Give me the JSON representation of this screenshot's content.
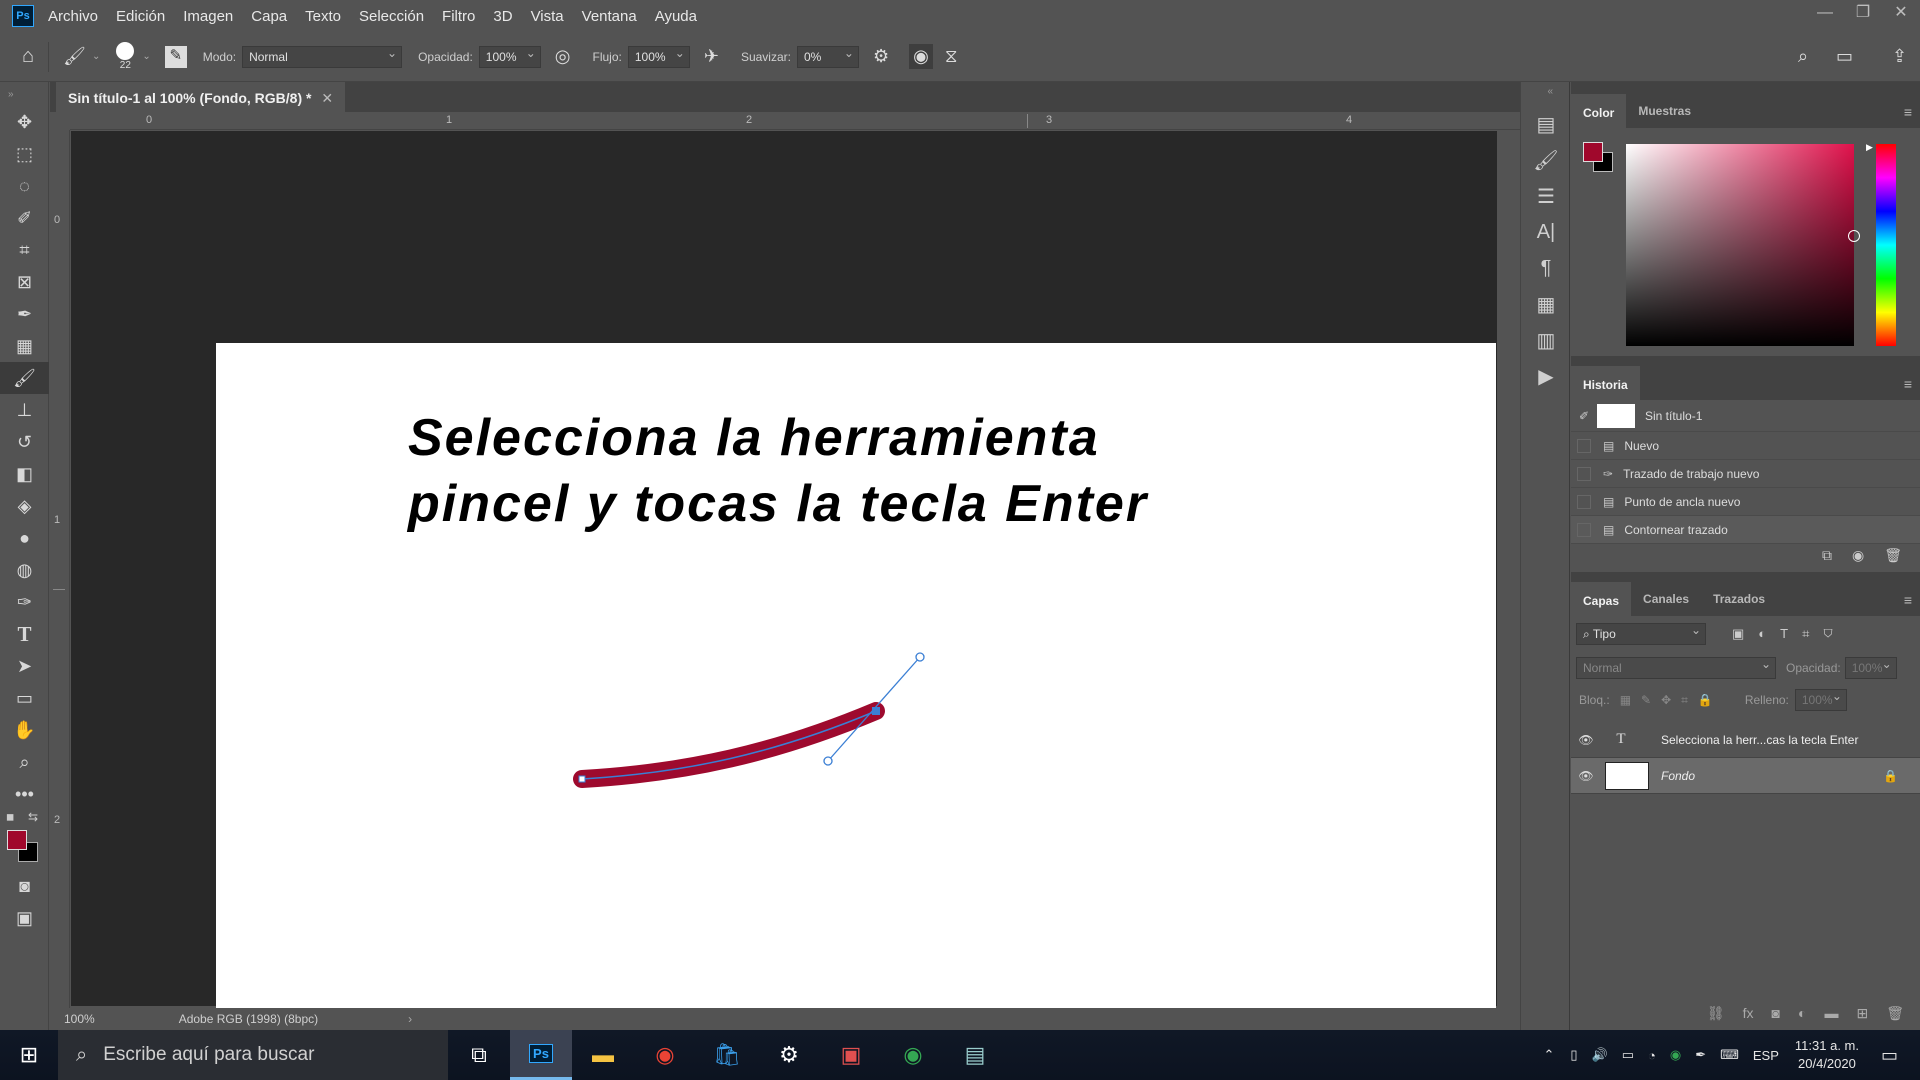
{
  "app": {
    "logo": "Ps"
  },
  "menu": [
    "Archivo",
    "Edición",
    "Imagen",
    "Capa",
    "Texto",
    "Selección",
    "Filtro",
    "3D",
    "Vista",
    "Ventana",
    "Ayuda"
  ],
  "options": {
    "brush_size": "22",
    "mode_label": "Modo:",
    "mode_value": "Normal",
    "opacity_label": "Opacidad:",
    "opacity_value": "100%",
    "flow_label": "Flujo:",
    "flow_value": "100%",
    "smooth_label": "Suavizar:",
    "smooth_value": "0%"
  },
  "document": {
    "tab_title": "Sin título-1 al 100% (Fondo, RGB/8) *",
    "canvas_line1": "Selecciona la herramienta",
    "canvas_line2": "pincel y tocas la tecla Enter",
    "stroke_color": "#9e0a2e",
    "path_color": "#3b7fd4"
  },
  "ruler": {
    "h": [
      "0",
      "1",
      "2",
      "3",
      "4"
    ],
    "v": [
      "0",
      "1",
      "2"
    ]
  },
  "status": {
    "zoom": "100%",
    "profile": "Adobe RGB (1998) (8bpc)"
  },
  "colors": {
    "foreground": "#a0082c",
    "background": "#000000",
    "accent": "#31a8ff"
  },
  "color_panel": {
    "tabs": [
      "Color",
      "Muestras"
    ]
  },
  "history": {
    "title": "Historia",
    "snapshot": "Sin título-1",
    "items": [
      "Nuevo",
      "Trazado de trabajo nuevo",
      "Punto de ancla nuevo",
      "Contornear trazado"
    ]
  },
  "layers_panel": {
    "tabs": [
      "Capas",
      "Canales",
      "Trazados"
    ],
    "filter": "Tipo",
    "blend": "Normal",
    "opacity_label": "Opacidad:",
    "opacity_value": "100%",
    "lock_label": "Bloq.:",
    "fill_label": "Relleno:",
    "fill_value": "100%",
    "layers": [
      {
        "name": "Selecciona la herr...cas la tecla Enter",
        "type": "text"
      },
      {
        "name": "Fondo",
        "type": "background"
      }
    ]
  },
  "taskbar": {
    "search_placeholder": "Escribe aquí para buscar",
    "lang": "ESP",
    "time": "11:31 a. m.",
    "date": "20/4/2020"
  }
}
